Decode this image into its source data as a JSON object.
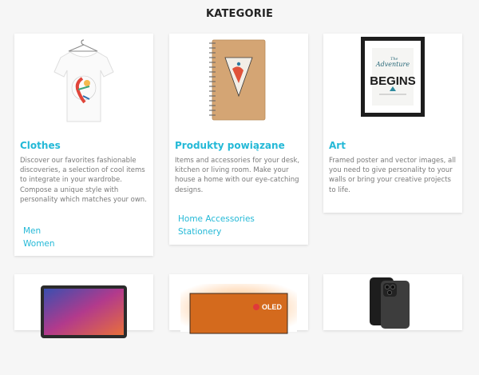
{
  "page": {
    "title": "KATEGORIE"
  },
  "categories": [
    {
      "name": "Clothes",
      "description": "Discover our favorites fashionable discoveries, a selection of cool items to integrate in your wardrobe. Compose a unique style with personality which matches your own.",
      "subcategories": [
        "Men",
        "Women"
      ],
      "image": "t-shirt-icon"
    },
    {
      "name": "Produkty powiązane",
      "description": "Items and accessories for your desk, kitchen or living room. Make your house a home with our eye-catching designs.",
      "subcategories": [
        "Home Accessories",
        "Stationery"
      ],
      "image": "notebook-icon"
    },
    {
      "name": "Art",
      "description": "Framed poster and vector images, all you need to give personality to your walls or bring your creative projects to life.",
      "subcategories": [],
      "image": "framed-poster-icon",
      "poster": {
        "line1": "The",
        "line2": "Adventure",
        "line3": "BEGINS"
      }
    },
    {
      "image": "laptop-icon"
    },
    {
      "image": "oled-tv-icon",
      "badge": "OLED"
    },
    {
      "image": "smartphone-icon"
    }
  ],
  "colors": {
    "accent": "#24b9d7",
    "text": "#7a7a7a",
    "background": "#f6f6f6"
  }
}
